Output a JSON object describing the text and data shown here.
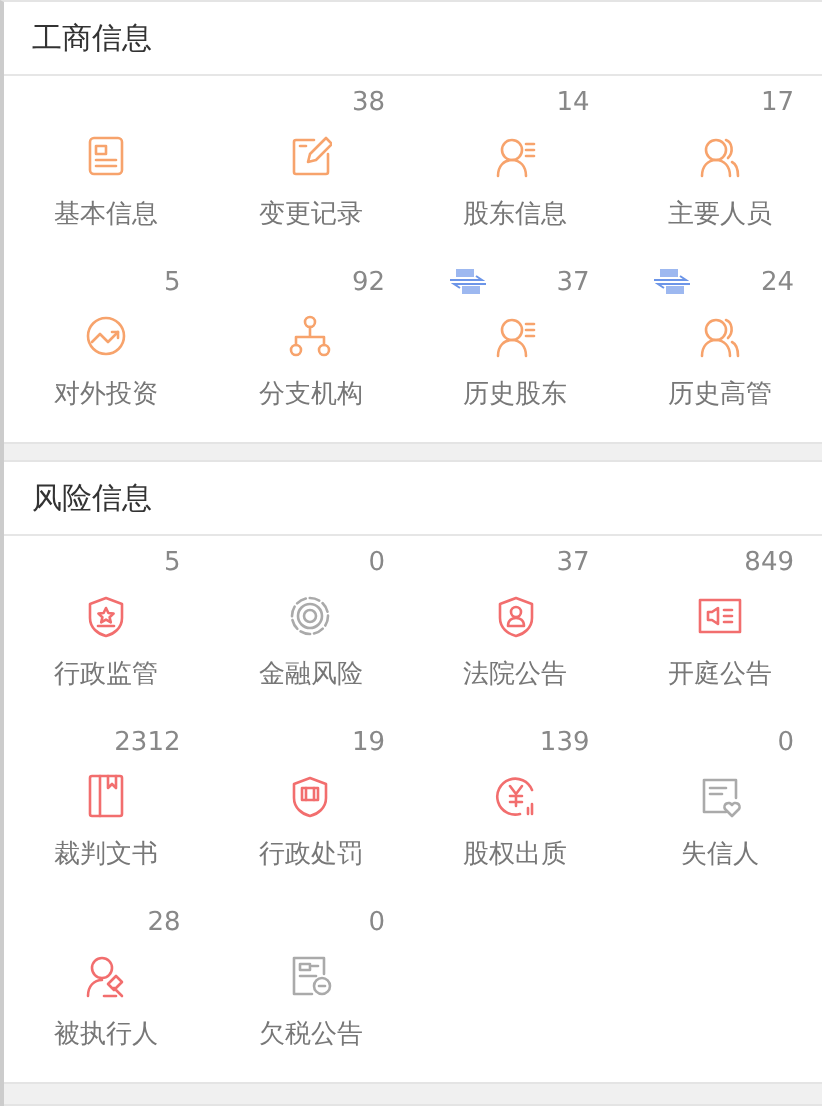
{
  "sections": [
    {
      "title": "工商信息",
      "kind": "business",
      "items": [
        {
          "label": "基本信息",
          "kind": "doc",
          "disabled": false,
          "history": false
        },
        {
          "label": "变更记录",
          "count": "38",
          "kind": "edit",
          "disabled": false,
          "history": false
        },
        {
          "label": "股东信息",
          "count": "14",
          "kind": "person-list",
          "disabled": false,
          "history": false
        },
        {
          "label": "主要人员",
          "count": "17",
          "kind": "people",
          "disabled": false,
          "history": false
        },
        {
          "label": "对外投资",
          "count": "5",
          "kind": "trend",
          "disabled": false,
          "history": false
        },
        {
          "label": "分支机构",
          "count": "92",
          "kind": "branch",
          "disabled": false,
          "history": false
        },
        {
          "label": "历史股东",
          "count": "37",
          "kind": "person-list",
          "disabled": false,
          "history": true
        },
        {
          "label": "历史高管",
          "count": "24",
          "kind": "people",
          "disabled": false,
          "history": true
        }
      ]
    },
    {
      "title": "风险信息",
      "kind": "risk",
      "items": [
        {
          "label": "行政监管",
          "count": "5",
          "kind": "shield-star",
          "disabled": false,
          "history": false
        },
        {
          "label": "金融风险",
          "count": "0",
          "kind": "target",
          "disabled": true,
          "history": false
        },
        {
          "label": "法院公告",
          "count": "37",
          "kind": "shield-person",
          "disabled": false,
          "history": false
        },
        {
          "label": "开庭公告",
          "count": "849",
          "kind": "speaker",
          "disabled": false,
          "history": false
        },
        {
          "label": "裁判文书",
          "count": "2312",
          "kind": "book",
          "disabled": false,
          "history": false
        },
        {
          "label": "行政处罚",
          "count": "19",
          "kind": "shield-fine",
          "disabled": false,
          "history": false
        },
        {
          "label": "股权出质",
          "count": "139",
          "kind": "yen",
          "disabled": false,
          "history": false
        },
        {
          "label": "失信人",
          "count": "0",
          "kind": "card-heart",
          "disabled": true,
          "history": false
        },
        {
          "label": "被执行人",
          "count": "28",
          "kind": "person-hammer",
          "disabled": false,
          "history": false
        },
        {
          "label": "欠税公告",
          "count": "0",
          "kind": "tax",
          "disabled": true,
          "history": false
        }
      ]
    }
  ]
}
